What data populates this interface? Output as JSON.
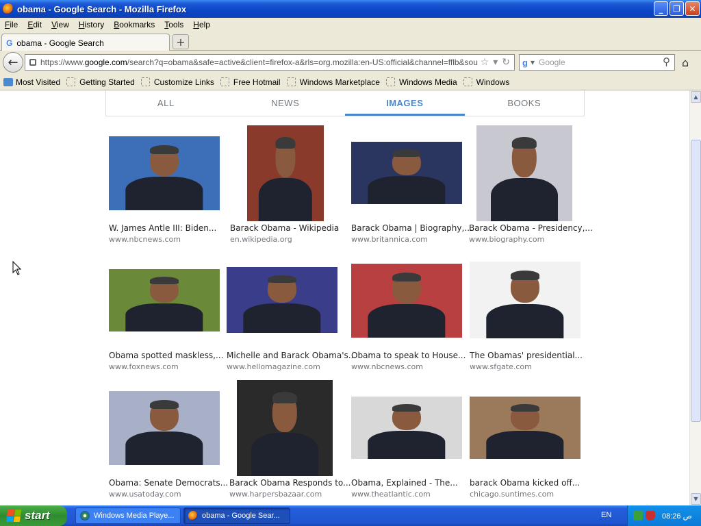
{
  "window": {
    "title": "obama - Google Search - Mozilla Firefox",
    "min": "_",
    "max": "❐",
    "close": "✕"
  },
  "menu": [
    "File",
    "Edit",
    "View",
    "History",
    "Bookmarks",
    "Tools",
    "Help"
  ],
  "tab": {
    "label": "obama - Google Search",
    "favicon": "G",
    "new_tab": "+"
  },
  "nav": {
    "url_prefix": "https://www.",
    "url_domain": "google.com",
    "url_rest": "/search?q=obama&safe=active&client=firefox-a&rls=org.mozilla:en-US:official&channel=fflb&source=lnm",
    "search_placeholder": "Google",
    "search_logo": "g"
  },
  "bookmarks": [
    "Most Visited",
    "Getting Started",
    "Customize Links",
    "Free Hotmail",
    "Windows Marketplace",
    "Windows Media",
    "Windows"
  ],
  "search_tabs": [
    "ALL",
    "NEWS",
    "IMAGES",
    "BOOKS"
  ],
  "results": [
    {
      "title": "W. James Antle III: Biden...",
      "source": "www.nbcnews.com",
      "bg": "#3d6fb8"
    },
    {
      "title": "Barack Obama - Wikipedia",
      "source": "en.wikipedia.org",
      "bg": "#8a3a2a"
    },
    {
      "title": "Barack Obama | Biography,...",
      "source": "www.britannica.com",
      "bg": "#2a3560"
    },
    {
      "title": "Barack Obama - Presidency,...",
      "source": "www.biography.com",
      "bg": "#c8c8d0"
    },
    {
      "title": "Obama spotted maskless,...",
      "source": "www.foxnews.com",
      "bg": "#6a8a3a"
    },
    {
      "title": "Michelle and Barack Obama's...",
      "source": "www.hellomagazine.com",
      "bg": "#3a3e8a"
    },
    {
      "title": "Obama to speak to House...",
      "source": "www.nbcnews.com",
      "bg": "#b84040"
    },
    {
      "title": "The Obamas' presidential...",
      "source": "www.sfgate.com",
      "bg": "#f2f2f2"
    },
    {
      "title": "Obama: Senate Democrats...",
      "source": "www.usatoday.com",
      "bg": "#a8b0c8"
    },
    {
      "title": "Barack Obama Responds to...",
      "source": "www.harpersbazaar.com",
      "bg": "#2a2a2a"
    },
    {
      "title": "Obama, Explained - The...",
      "source": "www.theatlantic.com",
      "bg": "#d8d8d8"
    },
    {
      "title": "barack Obama kicked off...",
      "source": "chicago.suntimes.com",
      "bg": "#9a7a5a"
    }
  ],
  "taskbar": {
    "start": "start",
    "tasks": [
      "Windows Media Playe...",
      "obama - Google Sear..."
    ],
    "lang": "EN",
    "clock": "08:26 ص"
  },
  "colors": {
    "accent": "#4a86c8",
    "titlebar": "#0a46c8",
    "taskbar": "#245edc"
  }
}
